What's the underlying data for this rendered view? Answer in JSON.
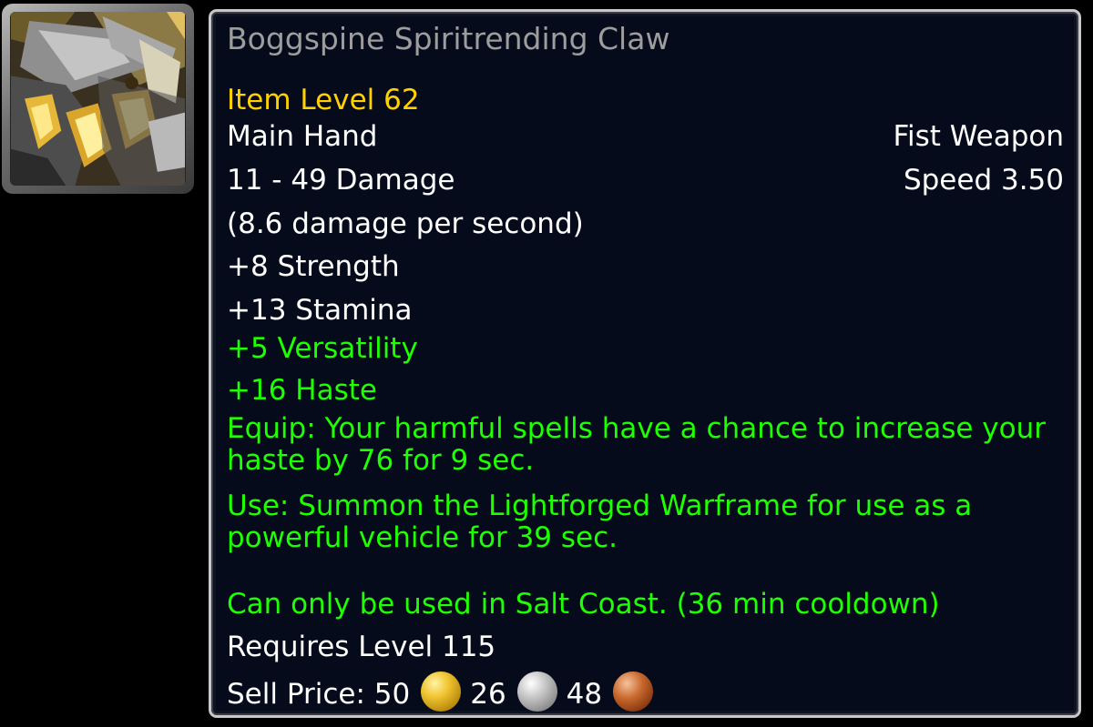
{
  "item": {
    "name": "Boggspine Spiritrending Claw",
    "item_level": "Item Level 62",
    "slot": "Main Hand",
    "weapon_type": "Fist Weapon",
    "damage": "11 - 49 Damage",
    "speed": "Speed 3.50",
    "dps": "(8.6 damage per second)",
    "stats": {
      "strength": "+8 Strength",
      "stamina": "+13 Stamina",
      "versatility": "+5 Versatility",
      "haste": "+16 Haste"
    },
    "equip_effect": "Equip: Your harmful spells have a chance to increase your haste by 76 for 9 sec.",
    "use_effect": "Use: Summon the Lightforged Warframe for use as a powerful vehicle for 39 sec.",
    "use_restriction": "Can only be used in Salt Coast. (36 min cooldown)",
    "requirement": "Requires Level 115",
    "sell_price": {
      "label": "Sell Price:",
      "gold": "50",
      "silver": "26",
      "copper": "48"
    }
  },
  "colors": {
    "name_poor_quality": "#9d9d9d",
    "item_level": "#ffd100",
    "effect_green": "#1eff00",
    "tooltip_background": "#060b1c",
    "tooltip_border": "#c8c8c8"
  },
  "icons": {
    "item": "fist-weapon-claw-icon",
    "gold": "gold-coin-icon",
    "silver": "silver-coin-icon",
    "copper": "copper-coin-icon"
  }
}
